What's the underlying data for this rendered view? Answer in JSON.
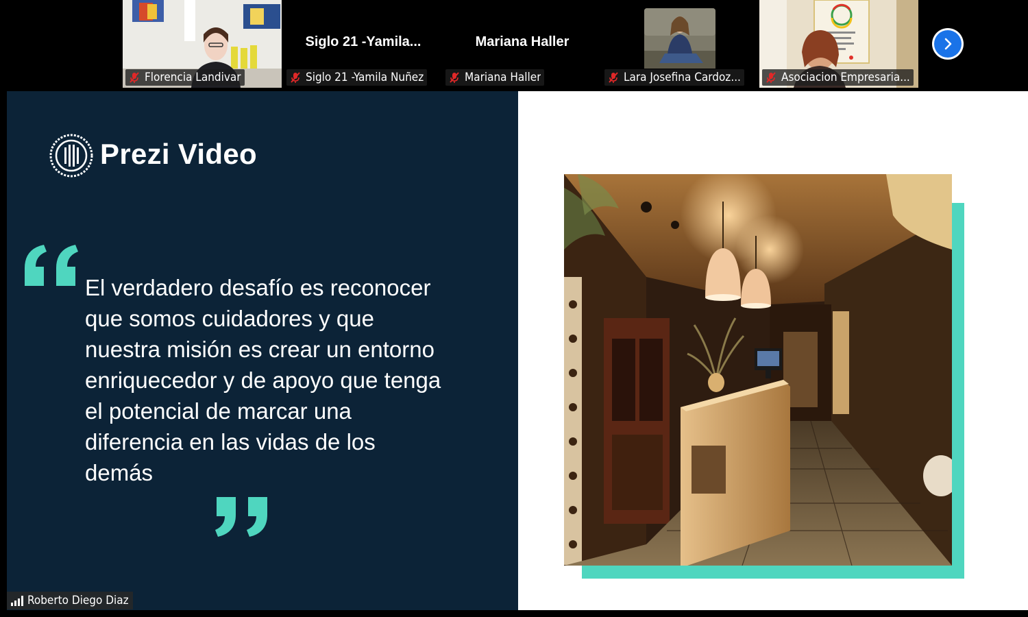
{
  "participants": [
    {
      "id": "p1",
      "name": "Florencia Landivar",
      "tile_title": ""
    },
    {
      "id": "p2",
      "name": "Siglo 21 -Yamila Nuñez",
      "tile_title": "Siglo  21  -Yamila..."
    },
    {
      "id": "p3",
      "name": "Mariana Haller",
      "tile_title": "Mariana Haller"
    },
    {
      "id": "p4",
      "name": "Lara Josefina Cardoz...",
      "tile_title": ""
    },
    {
      "id": "p5",
      "name": "Asociacion Empresaria...",
      "tile_title": ""
    }
  ],
  "icons": {
    "muted_mic": "mic-muted-icon",
    "next_page": "chevron-right-icon",
    "signal": "signal-bars-icon"
  },
  "slide": {
    "brand": "Prezi Video",
    "quote": "El verdadero desafío es reconocer que somos cuidadores y que nuestra misión es crear un entorno enriquecedor y de apoyo que tenga el potencial de marcar una diferencia en las vidas de los demás",
    "colors": {
      "panel": "#0c2337",
      "accent": "#4fd6bf",
      "text": "#ffffff"
    }
  },
  "speaker": {
    "name": "Roberto Diego Diaz"
  },
  "colors": {
    "mute_red": "#e02828",
    "zoom_blue": "#1a73e8"
  }
}
